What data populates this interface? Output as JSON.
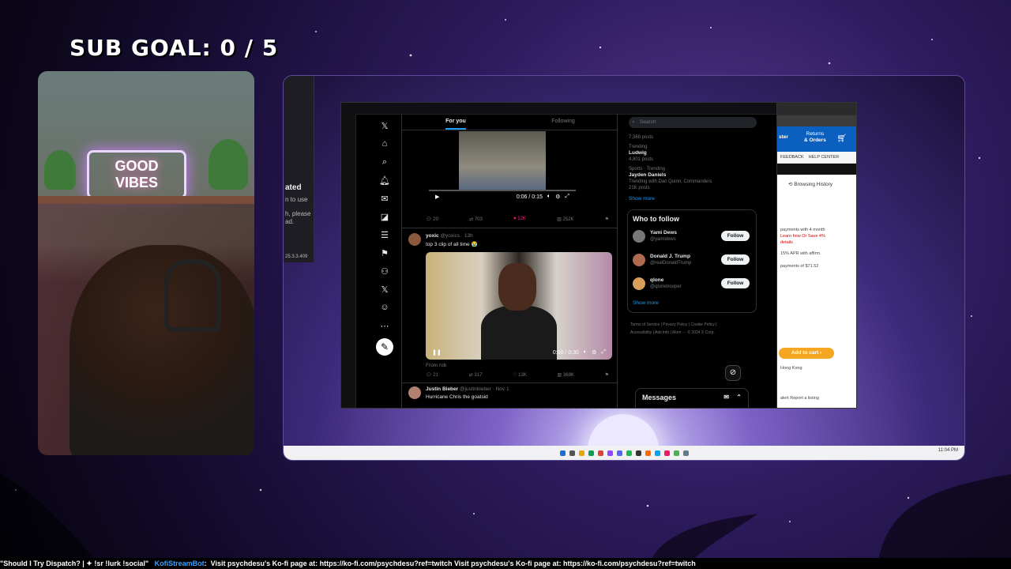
{
  "overlay": {
    "sub_goal": "SUB GOAL:  0 / 5",
    "neon_sign_line1": "GOOD",
    "neon_sign_line2": "VIBES"
  },
  "left_window": {
    "heading": "ated",
    "line1": "n to use",
    "line2": "h, please",
    "line3": "ad.",
    "version": "25.3.3.409"
  },
  "x_app": {
    "tabs": [
      "For you",
      "Following"
    ],
    "post1": {
      "time": "0:06 / 0:15",
      "replies": "20",
      "reposts": "703",
      "likes": "12K",
      "views": "252K"
    },
    "post2": {
      "name": "yoxic",
      "handle": "@yoxics · 13h",
      "text": "top 3 clip of all time 😭",
      "time": "0:00 / 0:30",
      "from": "From rob",
      "replies": "21",
      "reposts": "317",
      "likes": "13K",
      "views": "368K"
    },
    "post3": {
      "name": "Justin Bieber",
      "handle": "@justinbieber · Nov 1",
      "text": "Hurricane Chris the goatsid"
    },
    "search_placeholder": "Search",
    "trends": [
      {
        "meta": "7,368 posts",
        "name": "",
        "count": ""
      },
      {
        "meta": "Trending",
        "name": "Ludwig",
        "count": "4,801 posts"
      },
      {
        "meta": "Sports · Trending",
        "name": "Jayden Daniels",
        "count": "Trending with Dan Quinn, Commanders"
      },
      {
        "meta": "",
        "name": "",
        "count": "21K posts"
      }
    ],
    "show_more": "Show more",
    "who_to_follow": "Who to follow",
    "follow_list": [
      {
        "name": "Yami Dews",
        "handle": "@yamidews"
      },
      {
        "name": "Donald J. Trump",
        "handle": "@realDonaldTrump"
      },
      {
        "name": "qlone",
        "handle": "@qlonetrooper"
      }
    ],
    "follow_label": "Follow",
    "footer_line1": "Terms of Service  |  Privacy Policy  |  Cookie Policy  |",
    "footer_line2": "Accessibility  |  Ads info  |  More ···  © 2024 X Corp.",
    "messages": "Messages"
  },
  "store": {
    "ster": "ster",
    "returns": "Returns",
    "orders": "& Orders",
    "feedback": "FEEDBACK",
    "help": "HELP CENTER",
    "browsing_history": "Browsing History",
    "payments": "payments with 4 month",
    "learn": "Learn how Or Save 4%",
    "details": "details",
    "apr": "15% APR with affirm.",
    "payment_amt": "payments of $71.52",
    "add_to_cart": "Add to cart ›",
    "hong_kong": "Hong Kong",
    "report": "alert   Report a listing"
  },
  "taskbar": {
    "time": "11:04 PM"
  },
  "ticker": {
    "prefix": "\"Should I Try Dispatch? |  ✦  !sr !lurk !social\"",
    "bot": "KofiStreamBot",
    "message": "Visit psychdesu's Ko-fi page at: https://ko-fi.com/psychdesu?ref=twitch  Visit psychdesu's Ko-fi page at: https://ko-fi.com/psychdesu?ref=twitch"
  }
}
